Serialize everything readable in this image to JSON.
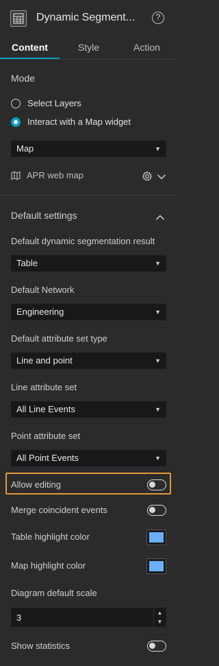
{
  "header": {
    "title": "Dynamic Segment...",
    "help_glyph": "?"
  },
  "tabs": [
    {
      "label": "Content",
      "active": true
    },
    {
      "label": "Style",
      "active": false
    },
    {
      "label": "Action",
      "active": false
    }
  ],
  "mode": {
    "title": "Mode",
    "options": [
      {
        "label": "Select Layers",
        "selected": false
      },
      {
        "label": "Interact with a Map widget",
        "selected": true
      }
    ],
    "map_select": "Map",
    "map_name": "APR web map"
  },
  "defaults": {
    "title": "Default settings",
    "fields": [
      {
        "label": "Default dynamic segmentation result",
        "value": "Table"
      },
      {
        "label": "Default Network",
        "value": "Engineering"
      },
      {
        "label": "Default attribute set type",
        "value": "Line and point"
      },
      {
        "label": "Line attribute set",
        "value": "All Line Events"
      },
      {
        "label": "Point attribute set",
        "value": "All Point Events"
      }
    ],
    "toggles": {
      "allow_editing": {
        "label": "Allow editing",
        "on": false
      },
      "merge_events": {
        "label": "Merge coincident events",
        "on": false
      },
      "show_statistics": {
        "label": "Show statistics",
        "on": false
      }
    },
    "colors": {
      "table_highlight": {
        "label": "Table highlight color",
        "value": "#6aaefc"
      },
      "map_highlight": {
        "label": "Map highlight color",
        "value": "#6aaefc"
      }
    },
    "diagram_scale": {
      "label": "Diagram default scale",
      "value": "3"
    }
  },
  "theme": {
    "accent": "#00a0c0",
    "highlight_border": "#e8963c"
  }
}
